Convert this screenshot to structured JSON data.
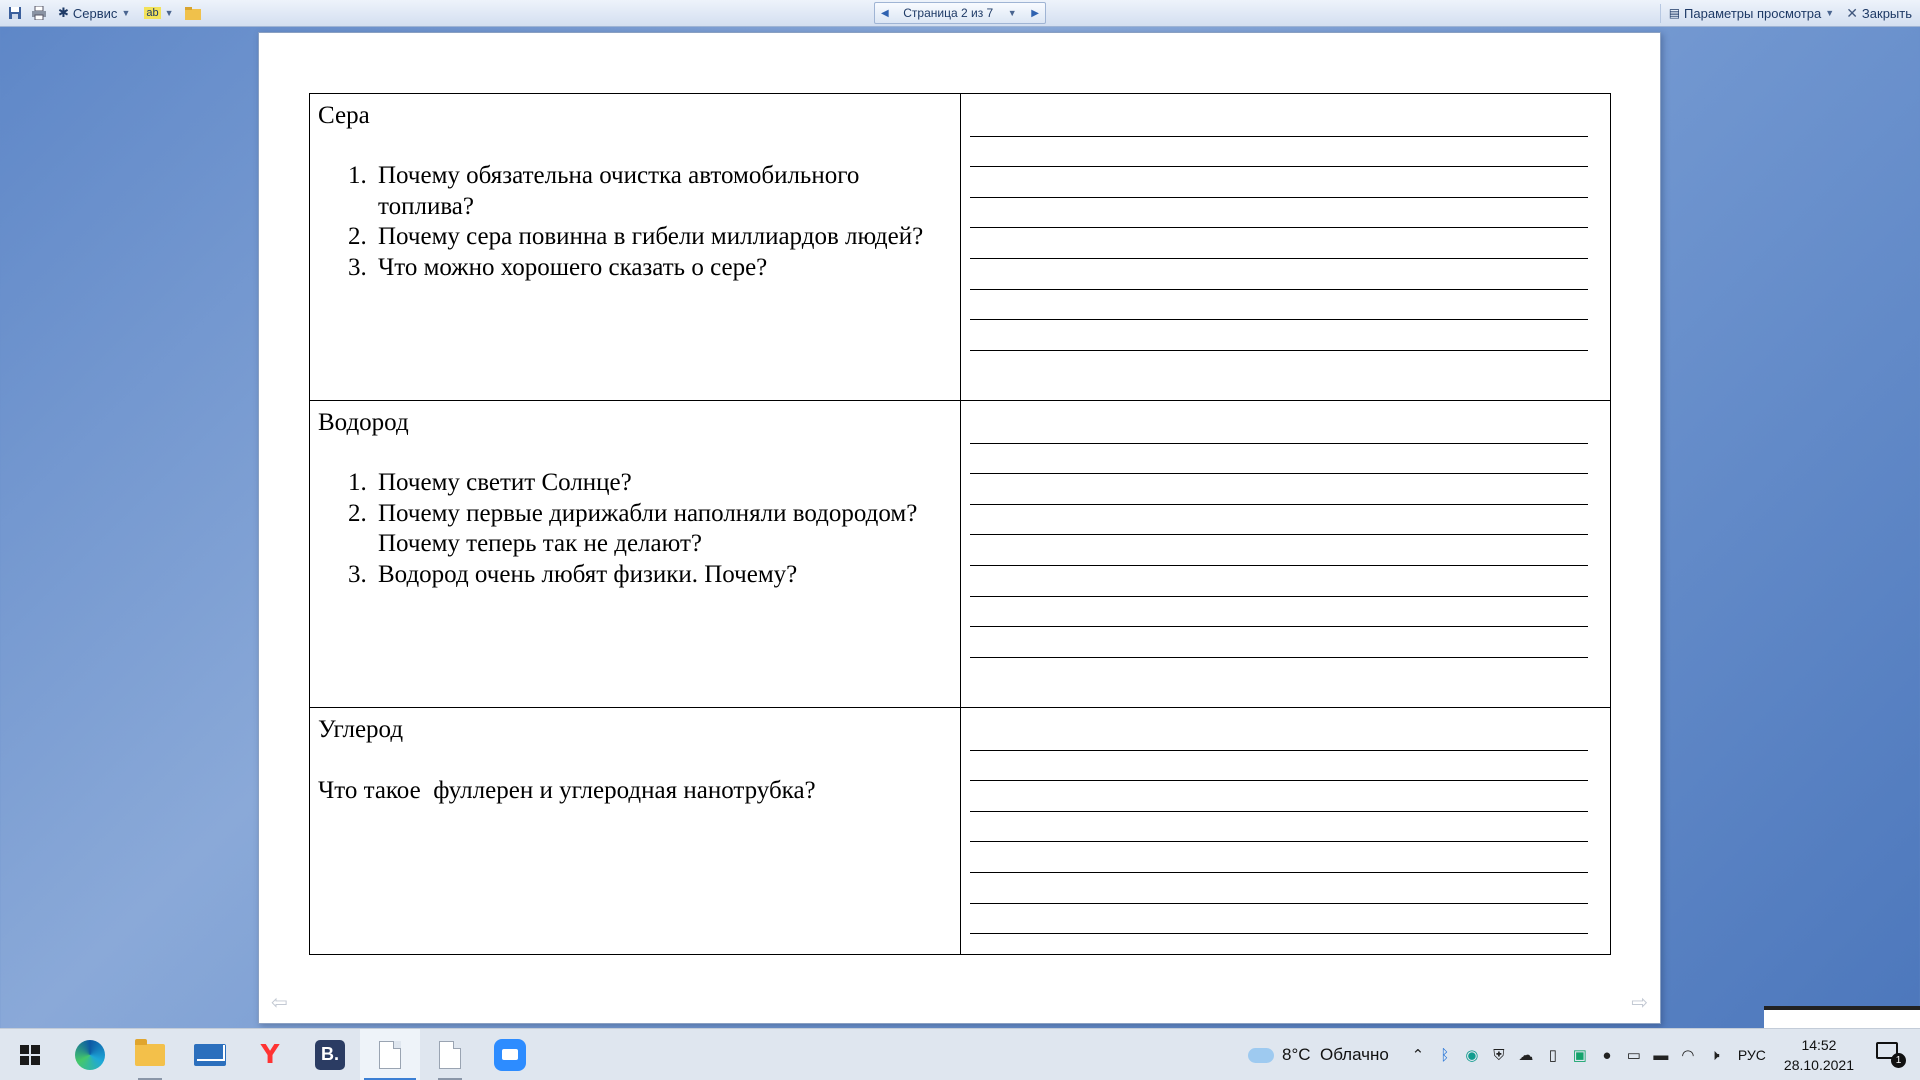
{
  "toolbar": {
    "service_label": "Сервис",
    "pager_label": "Страница 2 из 7",
    "view_options_label": "Параметры просмотра",
    "close_label": "Закрыть",
    "spell_label": "ab"
  },
  "worksheet": {
    "sections": [
      {
        "element": "Сера",
        "questions": [
          {
            "num": "1.",
            "text": "Почему обязательна очистка автомобильного топлива?"
          },
          {
            "num": "2.",
            "text": "Почему сера повинна в гибели миллиардов людей?"
          },
          {
            "num": "3.",
            "text": "Что можно хорошего сказать о сере?"
          }
        ],
        "answer_lines": 8
      },
      {
        "element": "Водород",
        "questions": [
          {
            "num": "1.",
            "text": "Почему светит Солнце?"
          },
          {
            "num": "2.",
            "text": "Почему первые дирижабли наполняли водородом? Почему теперь так не делают?"
          },
          {
            "num": "3.",
            "text": "Водород очень любят физики. Почему?"
          }
        ],
        "answer_lines": 8
      },
      {
        "element": "Углерод",
        "question_plain": "Что такое  фуллерен и углеродная нанотрубка?",
        "answer_lines": 7
      }
    ]
  },
  "taskbar": {
    "weather": "8°C  Облачно",
    "language": "РУС",
    "time": "14:52",
    "date": "28.10.2021",
    "notification_count": "1",
    "vb_label": "B."
  },
  "icons": [
    "save-icon",
    "print-icon",
    "service-icon",
    "spelling-icon",
    "folder-icon",
    "windows-start-icon",
    "edge-icon",
    "file-explorer-icon",
    "mail-icon",
    "yandex-icon",
    "vb-icon",
    "document-icon",
    "zoom-icon"
  ]
}
